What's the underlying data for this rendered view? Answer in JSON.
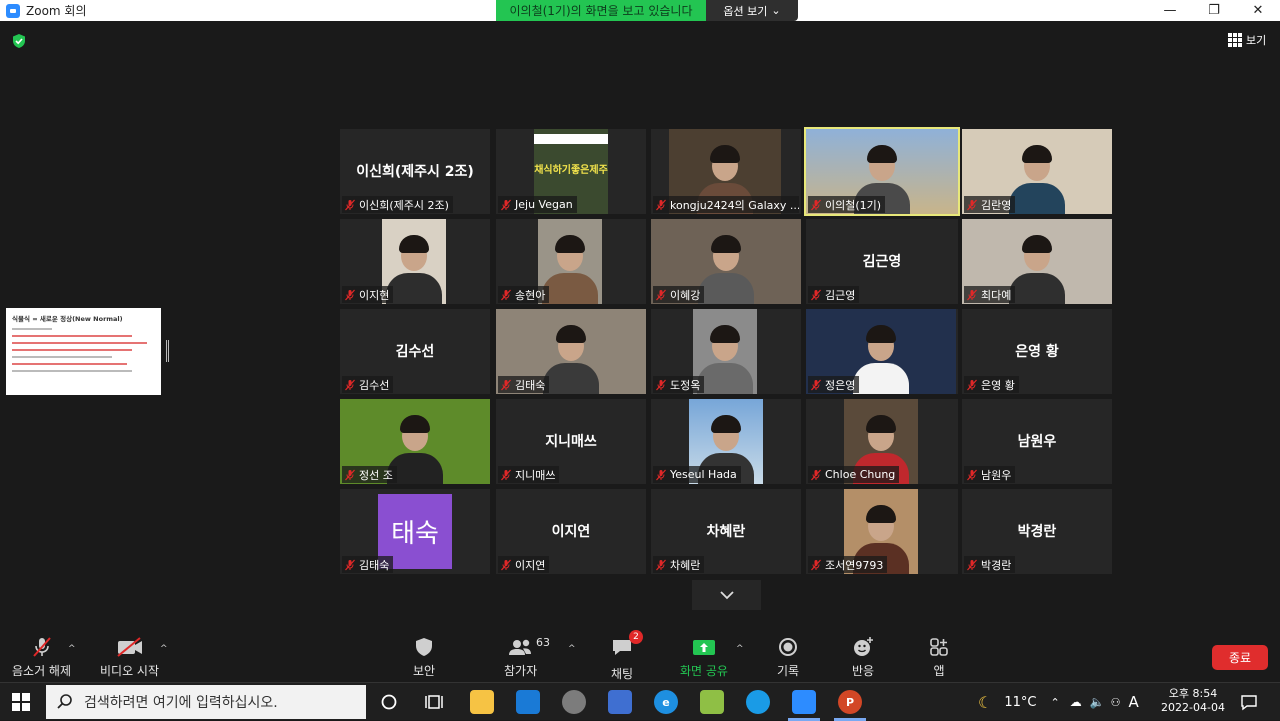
{
  "window": {
    "title": "Zoom 회의",
    "minimize": "—",
    "restore": "❐",
    "close": "✕"
  },
  "banner": {
    "viewing_text": "이의철(1기)의 화면을 보고 있습니다",
    "options_label": "옵션 보기",
    "options_caret": "⌄"
  },
  "view_button": {
    "label": "보기"
  },
  "shared_thumbnail": {
    "title": "식물식 = 새로운 정상(New Normal)"
  },
  "participants": [
    {
      "name": "이신희(제주시 2조)",
      "center": "이신희(제주시 2조)",
      "video": false
    },
    {
      "name": "Jeju Vegan",
      "center": "",
      "video": true
    },
    {
      "name": "kongju2424의 Galaxy ...",
      "center": "",
      "video": true
    },
    {
      "name": "이의철(1기)",
      "center": "",
      "video": true
    },
    {
      "name": "김란영",
      "center": "",
      "video": true
    },
    {
      "name": "이지현",
      "center": "",
      "video": true
    },
    {
      "name": "송현아",
      "center": "",
      "video": true
    },
    {
      "name": "이혜강",
      "center": "",
      "video": true
    },
    {
      "name": "김근영",
      "center": "김근영",
      "video": false
    },
    {
      "name": "최다예",
      "center": "",
      "video": true
    },
    {
      "name": "김수선",
      "center": "김수선",
      "video": false
    },
    {
      "name": "김태숙",
      "center": "",
      "video": true
    },
    {
      "name": "도정옥",
      "center": "",
      "video": true
    },
    {
      "name": "정은영",
      "center": "",
      "video": true
    },
    {
      "name": "은영 황",
      "center": "은영 황",
      "video": false
    },
    {
      "name": "정선 조",
      "center": "",
      "video": true
    },
    {
      "name": "지니매쓰",
      "center": "지니매쓰",
      "video": false
    },
    {
      "name": "Yeseul Hada",
      "center": "",
      "video": true
    },
    {
      "name": "Chloe Chung",
      "center": "",
      "video": true
    },
    {
      "name": "남원우",
      "center": "남원우",
      "video": false
    },
    {
      "name": "김태숙",
      "center": "",
      "video": true
    },
    {
      "name": "이지연",
      "center": "이지연",
      "video": false
    },
    {
      "name": "차혜란",
      "center": "차혜란",
      "video": false
    },
    {
      "name": "조서연9793",
      "center": "",
      "video": true
    },
    {
      "name": "박경란",
      "center": "박경란",
      "video": false
    }
  ],
  "avatar_text": "태숙",
  "video_sign_text": "채식하기좋은제주",
  "toolbar": {
    "unmute": "음소거 해제",
    "start_video": "비디오 시작",
    "security": "보안",
    "participants": "참가자",
    "participant_count": "63",
    "chat": "채팅",
    "chat_badge": "2",
    "share_screen": "화면 공유",
    "record": "기록",
    "reactions": "반응",
    "apps": "앱",
    "end": "종료",
    "caret": "^"
  },
  "taskbar": {
    "search_placeholder": "검색하려면 여기에 입력하십시오.",
    "weather": "11°C",
    "ime": "A",
    "time": "오후 8:54",
    "date": "2022-04-04"
  },
  "colors": {
    "banner_green": "#23c552",
    "end_red": "#e02d2d",
    "active_speaker": "#e8e87a",
    "share_green": "#23c552",
    "avatar_purple": "#8a4fd1"
  }
}
